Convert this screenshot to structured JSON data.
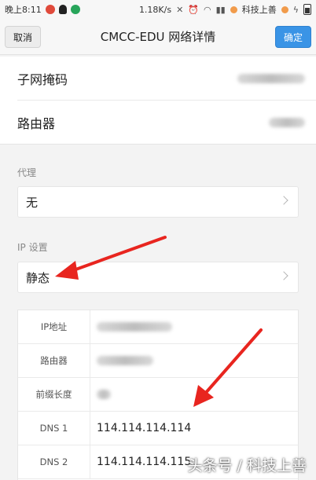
{
  "status_bar": {
    "time": "晚上8:11",
    "speed": "1.18K/s",
    "brand": "科技上善"
  },
  "nav": {
    "cancel_label": "取消",
    "title": "CMCC-EDU  网络详情",
    "ok_label": "确定"
  },
  "network_info": {
    "subnet_label": "子网掩码",
    "router_label": "路由器"
  },
  "proxy": {
    "section_label": "代理",
    "value": "无"
  },
  "ip_settings": {
    "section_label": "IP 设置",
    "value": "静态"
  },
  "static_fields": [
    {
      "label": "IP地址",
      "value": ""
    },
    {
      "label": "路由器",
      "value": ""
    },
    {
      "label": "前缀长度",
      "value": ""
    },
    {
      "label": "DNS 1",
      "value": "114.114.114.114"
    },
    {
      "label": "DNS 2",
      "value": "114.114.114.115"
    }
  ],
  "annotation_color": "#e8251f",
  "accent_color": "#3a94e6",
  "watermark": "头条号 / 科技上善"
}
